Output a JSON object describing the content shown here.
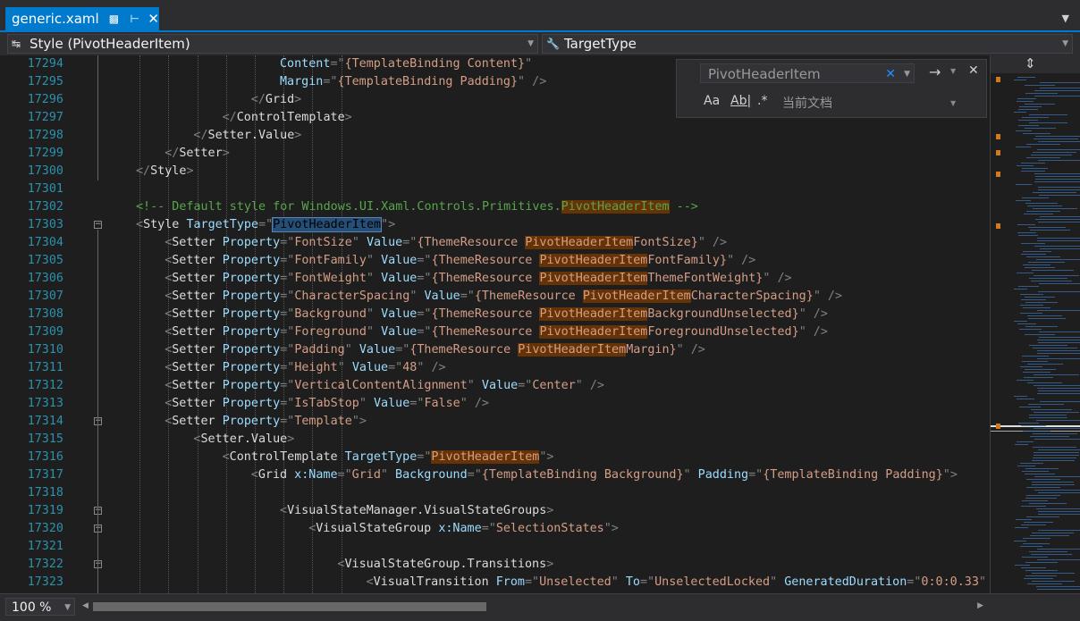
{
  "tab": {
    "title": "generic.xaml",
    "pin_icon": "lock-icon",
    "dock_icon": "pin-icon",
    "close_icon": "close-icon"
  },
  "nav": {
    "left": "Style (PivotHeaderItem)",
    "right": "TargetType"
  },
  "find": {
    "query": "PivotHeaderItem",
    "scope": "当前文档",
    "case_label": "Aa",
    "word_label": "Ab|",
    "regex_label": ".*"
  },
  "status": {
    "zoom": "100 %"
  },
  "lines": [
    {
      "n": "17294",
      "segs": [
        [
          "a",
          "Content"
        ],
        [
          "b",
          "=\""
        ],
        [
          "v",
          "{TemplateBinding Content}"
        ],
        [
          "b",
          "\""
        ]
      ]
    },
    {
      "n": "17295",
      "segs": [
        [
          "a",
          "Margin"
        ],
        [
          "b",
          "=\""
        ],
        [
          "v",
          "{TemplateBinding Padding}"
        ],
        [
          "b",
          "\" />"
        ]
      ]
    },
    {
      "n": "17296",
      "segs": [
        [
          "b",
          "</"
        ],
        [
          "t",
          "Grid"
        ],
        [
          "b",
          ">"
        ]
      ]
    },
    {
      "n": "17297",
      "segs": [
        [
          "b",
          "</"
        ],
        [
          "t",
          "ControlTemplate"
        ],
        [
          "b",
          ">"
        ]
      ]
    },
    {
      "n": "17298",
      "segs": [
        [
          "b",
          "</"
        ],
        [
          "t",
          "Setter.Value"
        ],
        [
          "b",
          ">"
        ]
      ]
    },
    {
      "n": "17299",
      "segs": [
        [
          "b",
          "</"
        ],
        [
          "t",
          "Setter"
        ],
        [
          "b",
          ">"
        ]
      ]
    },
    {
      "n": "17300",
      "segs": [
        [
          "b",
          "</"
        ],
        [
          "t",
          "Style"
        ],
        [
          "b",
          ">"
        ]
      ]
    },
    {
      "n": "17301",
      "segs": []
    },
    {
      "n": "17302",
      "segs": [
        [
          "c",
          "<!-- Default style for Windows.UI.Xaml.Controls.Primitives."
        ],
        [
          "hlc",
          "PivotHeaderItem"
        ],
        [
          "c",
          " -->"
        ]
      ]
    },
    {
      "n": "17303",
      "segs": [
        [
          "b",
          "<"
        ],
        [
          "t",
          "Style"
        ],
        [
          "s",
          " "
        ],
        [
          "a",
          "TargetType"
        ],
        [
          "b",
          "=\""
        ],
        [
          "sel",
          "PivotHeaderItem"
        ],
        [
          "b",
          "\">"
        ]
      ]
    },
    {
      "n": "17304",
      "segs": [
        [
          "b",
          "<"
        ],
        [
          "t",
          "Setter"
        ],
        [
          "s",
          " "
        ],
        [
          "a",
          "Property"
        ],
        [
          "b",
          "=\""
        ],
        [
          "v",
          "FontSize"
        ],
        [
          "b",
          "\" "
        ],
        [
          "a",
          "Value"
        ],
        [
          "b",
          "=\""
        ],
        [
          "v",
          "{ThemeResource "
        ],
        [
          "hl",
          "PivotHeaderItem"
        ],
        [
          "v",
          "FontSize}"
        ],
        [
          "b",
          "\" />"
        ]
      ]
    },
    {
      "n": "17305",
      "segs": [
        [
          "b",
          "<"
        ],
        [
          "t",
          "Setter"
        ],
        [
          "s",
          " "
        ],
        [
          "a",
          "Property"
        ],
        [
          "b",
          "=\""
        ],
        [
          "v",
          "FontFamily"
        ],
        [
          "b",
          "\" "
        ],
        [
          "a",
          "Value"
        ],
        [
          "b",
          "=\""
        ],
        [
          "v",
          "{ThemeResource "
        ],
        [
          "hl",
          "PivotHeaderItem"
        ],
        [
          "v",
          "FontFamily}"
        ],
        [
          "b",
          "\" />"
        ]
      ]
    },
    {
      "n": "17306",
      "segs": [
        [
          "b",
          "<"
        ],
        [
          "t",
          "Setter"
        ],
        [
          "s",
          " "
        ],
        [
          "a",
          "Property"
        ],
        [
          "b",
          "=\""
        ],
        [
          "v",
          "FontWeight"
        ],
        [
          "b",
          "\" "
        ],
        [
          "a",
          "Value"
        ],
        [
          "b",
          "=\""
        ],
        [
          "v",
          "{ThemeResource "
        ],
        [
          "hl",
          "PivotHeaderItem"
        ],
        [
          "v",
          "ThemeFontWeight}"
        ],
        [
          "b",
          "\" />"
        ]
      ]
    },
    {
      "n": "17307",
      "segs": [
        [
          "b",
          "<"
        ],
        [
          "t",
          "Setter"
        ],
        [
          "s",
          " "
        ],
        [
          "a",
          "Property"
        ],
        [
          "b",
          "=\""
        ],
        [
          "v",
          "CharacterSpacing"
        ],
        [
          "b",
          "\" "
        ],
        [
          "a",
          "Value"
        ],
        [
          "b",
          "=\""
        ],
        [
          "v",
          "{ThemeResource "
        ],
        [
          "hl",
          "PivotHeaderItem"
        ],
        [
          "v",
          "CharacterSpacing}"
        ],
        [
          "b",
          "\" />"
        ]
      ]
    },
    {
      "n": "17308",
      "segs": [
        [
          "b",
          "<"
        ],
        [
          "t",
          "Setter"
        ],
        [
          "s",
          " "
        ],
        [
          "a",
          "Property"
        ],
        [
          "b",
          "=\""
        ],
        [
          "v",
          "Background"
        ],
        [
          "b",
          "\" "
        ],
        [
          "a",
          "Value"
        ],
        [
          "b",
          "=\""
        ],
        [
          "v",
          "{ThemeResource "
        ],
        [
          "hl",
          "PivotHeaderItem"
        ],
        [
          "v",
          "BackgroundUnselected}"
        ],
        [
          "b",
          "\" />"
        ]
      ]
    },
    {
      "n": "17309",
      "segs": [
        [
          "b",
          "<"
        ],
        [
          "t",
          "Setter"
        ],
        [
          "s",
          " "
        ],
        [
          "a",
          "Property"
        ],
        [
          "b",
          "=\""
        ],
        [
          "v",
          "Foreground"
        ],
        [
          "b",
          "\" "
        ],
        [
          "a",
          "Value"
        ],
        [
          "b",
          "=\""
        ],
        [
          "v",
          "{ThemeResource "
        ],
        [
          "hl",
          "PivotHeaderItem"
        ],
        [
          "v",
          "ForegroundUnselected}"
        ],
        [
          "b",
          "\" />"
        ]
      ]
    },
    {
      "n": "17310",
      "segs": [
        [
          "b",
          "<"
        ],
        [
          "t",
          "Setter"
        ],
        [
          "s",
          " "
        ],
        [
          "a",
          "Property"
        ],
        [
          "b",
          "=\""
        ],
        [
          "v",
          "Padding"
        ],
        [
          "b",
          "\" "
        ],
        [
          "a",
          "Value"
        ],
        [
          "b",
          "=\""
        ],
        [
          "v",
          "{ThemeResource "
        ],
        [
          "hl",
          "PivotHeaderItem"
        ],
        [
          "v",
          "Margin}"
        ],
        [
          "b",
          "\" />"
        ]
      ]
    },
    {
      "n": "17311",
      "segs": [
        [
          "b",
          "<"
        ],
        [
          "t",
          "Setter"
        ],
        [
          "s",
          " "
        ],
        [
          "a",
          "Property"
        ],
        [
          "b",
          "=\""
        ],
        [
          "v",
          "Height"
        ],
        [
          "b",
          "\" "
        ],
        [
          "a",
          "Value"
        ],
        [
          "b",
          "=\""
        ],
        [
          "v",
          "48"
        ],
        [
          "b",
          "\" />"
        ]
      ]
    },
    {
      "n": "17312",
      "segs": [
        [
          "b",
          "<"
        ],
        [
          "t",
          "Setter"
        ],
        [
          "s",
          " "
        ],
        [
          "a",
          "Property"
        ],
        [
          "b",
          "=\""
        ],
        [
          "v",
          "VerticalContentAlignment"
        ],
        [
          "b",
          "\" "
        ],
        [
          "a",
          "Value"
        ],
        [
          "b",
          "=\""
        ],
        [
          "v",
          "Center"
        ],
        [
          "b",
          "\" />"
        ]
      ]
    },
    {
      "n": "17313",
      "segs": [
        [
          "b",
          "<"
        ],
        [
          "t",
          "Setter"
        ],
        [
          "s",
          " "
        ],
        [
          "a",
          "Property"
        ],
        [
          "b",
          "=\""
        ],
        [
          "v",
          "IsTabStop"
        ],
        [
          "b",
          "\" "
        ],
        [
          "a",
          "Value"
        ],
        [
          "b",
          "=\""
        ],
        [
          "v",
          "False"
        ],
        [
          "b",
          "\" />"
        ]
      ]
    },
    {
      "n": "17314",
      "segs": [
        [
          "b",
          "<"
        ],
        [
          "t",
          "Setter"
        ],
        [
          "s",
          " "
        ],
        [
          "a",
          "Property"
        ],
        [
          "b",
          "=\""
        ],
        [
          "v",
          "Template"
        ],
        [
          "b",
          "\">"
        ]
      ]
    },
    {
      "n": "17315",
      "segs": [
        [
          "b",
          "<"
        ],
        [
          "t",
          "Setter.Value"
        ],
        [
          "b",
          ">"
        ]
      ]
    },
    {
      "n": "17316",
      "segs": [
        [
          "b",
          "<"
        ],
        [
          "t",
          "ControlTemplate"
        ],
        [
          "s",
          " "
        ],
        [
          "a",
          "TargetType"
        ],
        [
          "b",
          "=\""
        ],
        [
          "hl",
          "PivotHeaderItem"
        ],
        [
          "b",
          "\">"
        ]
      ]
    },
    {
      "n": "17317",
      "segs": [
        [
          "b",
          "<"
        ],
        [
          "t",
          "Grid"
        ],
        [
          "s",
          " "
        ],
        [
          "a",
          "x:Name"
        ],
        [
          "b",
          "=\""
        ],
        [
          "v",
          "Grid"
        ],
        [
          "b",
          "\" "
        ],
        [
          "a",
          "Background"
        ],
        [
          "b",
          "=\""
        ],
        [
          "v",
          "{TemplateBinding Background}"
        ],
        [
          "b",
          "\" "
        ],
        [
          "a",
          "Padding"
        ],
        [
          "b",
          "=\""
        ],
        [
          "v",
          "{TemplateBinding Padding}"
        ],
        [
          "b",
          "\">"
        ]
      ]
    },
    {
      "n": "17318",
      "segs": []
    },
    {
      "n": "17319",
      "segs": [
        [
          "b",
          "<"
        ],
        [
          "t",
          "VisualStateManager.VisualStateGroups"
        ],
        [
          "b",
          ">"
        ]
      ]
    },
    {
      "n": "17320",
      "segs": [
        [
          "b",
          "<"
        ],
        [
          "t",
          "VisualStateGroup"
        ],
        [
          "s",
          " "
        ],
        [
          "a",
          "x:Name"
        ],
        [
          "b",
          "=\""
        ],
        [
          "v",
          "SelectionStates"
        ],
        [
          "b",
          "\">"
        ]
      ]
    },
    {
      "n": "17321",
      "segs": []
    },
    {
      "n": "17322",
      "segs": [
        [
          "b",
          "<"
        ],
        [
          "t",
          "VisualStateGroup.Transitions"
        ],
        [
          "b",
          ">"
        ]
      ]
    },
    {
      "n": "17323",
      "segs": [
        [
          "b",
          "<"
        ],
        [
          "t",
          "VisualTransition"
        ],
        [
          "s",
          " "
        ],
        [
          "a",
          "From"
        ],
        [
          "b",
          "=\""
        ],
        [
          "v",
          "Unselected"
        ],
        [
          "b",
          "\" "
        ],
        [
          "a",
          "To"
        ],
        [
          "b",
          "=\""
        ],
        [
          "v",
          "UnselectedLocked"
        ],
        [
          "b",
          "\" "
        ],
        [
          "a",
          "GeneratedDuration"
        ],
        [
          "b",
          "=\""
        ],
        [
          "v",
          "0:0:0.33"
        ],
        [
          "b",
          "\" /"
        ]
      ]
    }
  ]
}
